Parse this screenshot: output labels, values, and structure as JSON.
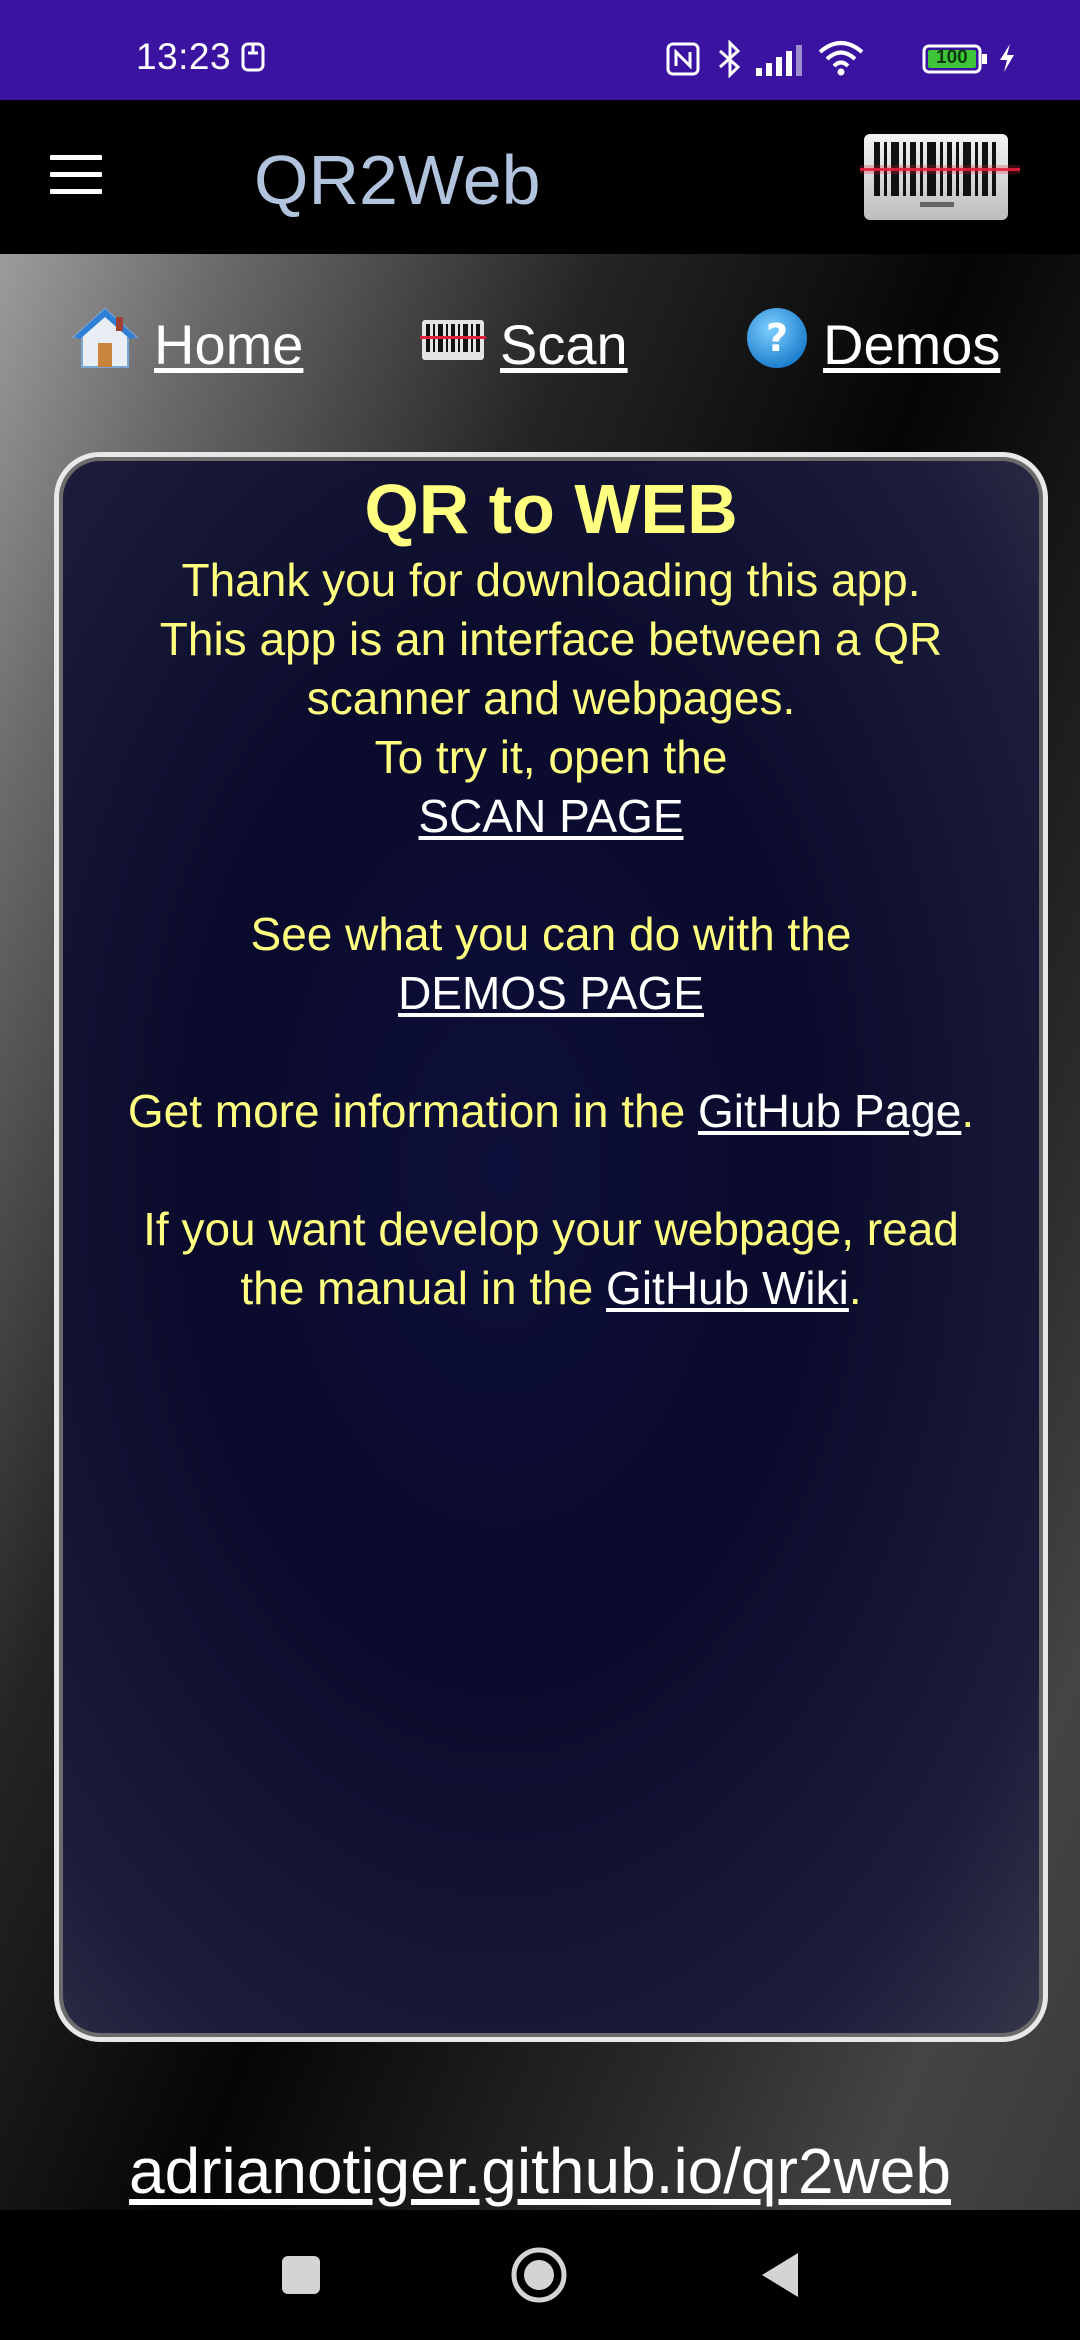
{
  "status_bar": {
    "time": "13:23",
    "battery": "100",
    "icons": [
      "nfc-icon",
      "bluetooth-icon",
      "signal-icon",
      "wifi-icon",
      "battery-icon",
      "charging-icon"
    ],
    "background": "#3a13a0"
  },
  "app_bar": {
    "title": "QR2Web",
    "title_color": "#b1c3dd"
  },
  "nav": {
    "home": "Home",
    "scan": "Scan",
    "demos": "Demos"
  },
  "card": {
    "title": "QR to WEB",
    "line1": "Thank you for downloading this app.",
    "line2": "This app is an interface between a QR scanner and webpages.",
    "line3": "To try it, open the",
    "scan_link": "SCAN PAGE",
    "line4": "See what you can do with the",
    "demos_link": "DEMOS PAGE",
    "line5_prefix": "Get more information in the ",
    "github_page_link": "GitHub Page",
    "line5_suffix": ".",
    "line6": "If you want develop your webpage, read",
    "line7_prefix": "the manual in the ",
    "github_wiki_link": "GitHub Wiki",
    "line7_suffix": ".",
    "text_color": "#ffff80"
  },
  "footer": {
    "link": "adrianotiger.github.io/qr2web"
  }
}
